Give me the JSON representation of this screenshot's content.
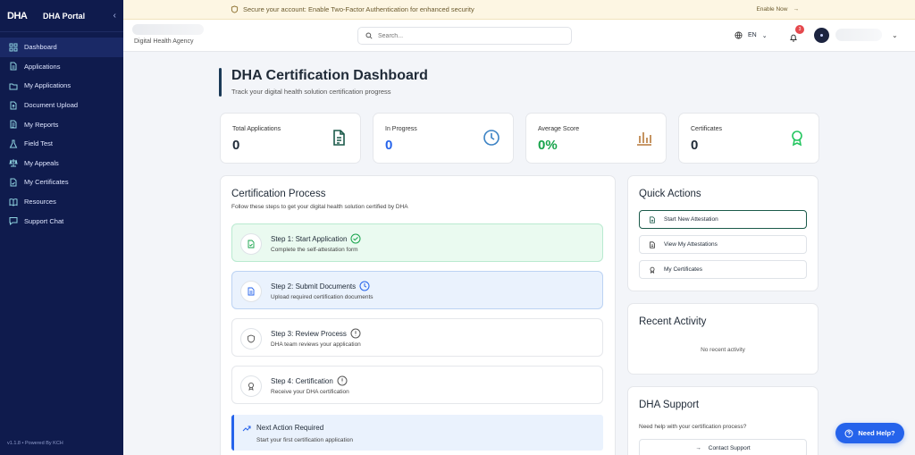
{
  "sidebar": {
    "logo": "DHA",
    "title": "DHA Portal",
    "collapse_icon": "chevron-left-icon",
    "items": [
      {
        "label": "Dashboard",
        "icon": "dashboard-icon",
        "active": true
      },
      {
        "label": "Applications",
        "icon": "file-icon"
      },
      {
        "label": "My Applications",
        "icon": "folder-icon"
      },
      {
        "label": "Document Upload",
        "icon": "upload-icon"
      },
      {
        "label": "My Reports",
        "icon": "report-icon"
      },
      {
        "label": "Field Test",
        "icon": "flask-icon"
      },
      {
        "label": "My Appeals",
        "icon": "scale-icon"
      },
      {
        "label": "My Certificates",
        "icon": "certificate-icon"
      },
      {
        "label": "Resources",
        "icon": "book-icon"
      },
      {
        "label": "Support Chat",
        "icon": "chat-icon"
      }
    ],
    "footer": "v1.1.8 • Powered By KCH"
  },
  "banner": {
    "text": "Secure your account: Enable Two-Factor Authentication for enhanced security",
    "cta": "Enable Now"
  },
  "header": {
    "agency": "Digital Health Agency",
    "search_placeholder": "Search...",
    "language": "EN",
    "notifications": "3"
  },
  "page": {
    "title": "DHA Certification Dashboard",
    "subtitle": "Track your digital health solution certification progress"
  },
  "stats": [
    {
      "label": "Total Applications",
      "value": "0",
      "color": "#1f2a37",
      "icon": "document-icon",
      "icon_color": "#1b5a4a"
    },
    {
      "label": "In Progress",
      "value": "0",
      "color": "#2563eb",
      "icon": "clock-icon",
      "icon_color": "#2563eb"
    },
    {
      "label": "Average Score",
      "value": "0%",
      "color": "#16a34a",
      "icon": "bar-chart-icon",
      "icon_color": "#b7793a"
    },
    {
      "label": "Certificates",
      "value": "0",
      "color": "#1f2a37",
      "icon": "award-icon",
      "icon_color": "#22c55e"
    }
  ],
  "process": {
    "title": "Certification Process",
    "subtitle": "Follow these steps to get your digital health solution certified by DHA",
    "steps": [
      {
        "title": "Step 1: Start Application",
        "desc": "Complete the self-attestation form",
        "state": "done"
      },
      {
        "title": "Step 2: Submit Documents",
        "desc": "Upload required certification documents",
        "state": "current"
      },
      {
        "title": "Step 3: Review Process",
        "desc": "DHA team reviews your application",
        "state": "pending"
      },
      {
        "title": "Step 4: Certification",
        "desc": "Receive your DHA certification",
        "state": "pending"
      }
    ],
    "next_action": {
      "title": "Next Action Required",
      "desc": "Start your first certification application"
    }
  },
  "quick_actions": {
    "title": "Quick Actions",
    "items": [
      {
        "label": "Start New Attestation",
        "icon": "file-plus-icon"
      },
      {
        "label": "View My Attestations",
        "icon": "list-icon"
      },
      {
        "label": "My Certificates",
        "icon": "award-icon"
      }
    ]
  },
  "recent_activity": {
    "title": "Recent Activity",
    "empty": "No recent activity"
  },
  "support": {
    "title": "DHA Support",
    "subtitle": "Need help with your certification process?",
    "button": "Contact Support"
  },
  "need_help": "Need Help?"
}
